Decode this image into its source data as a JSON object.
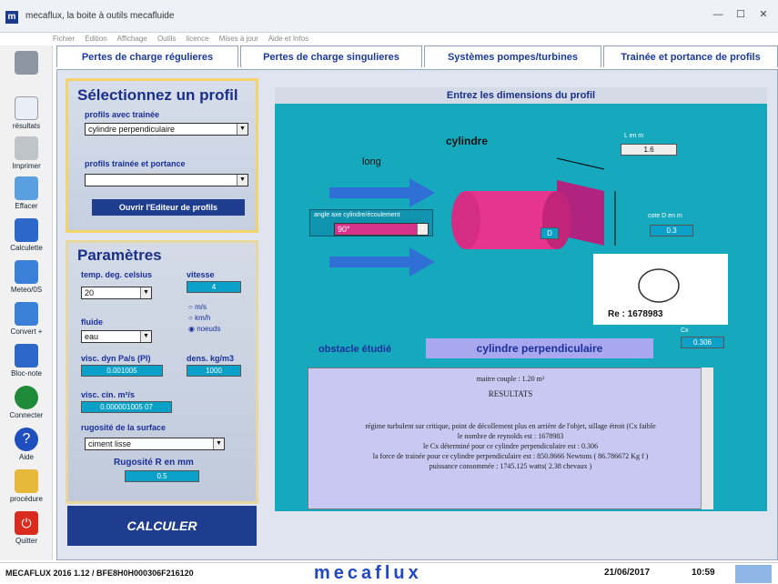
{
  "window": {
    "title": "mecaflux, la boite à outils mecafluide",
    "menu": [
      "Fichier",
      "Edition",
      "Affichage",
      "Outils",
      "licence",
      "Mises à jour",
      "Aide et Infos"
    ],
    "controls": [
      "—",
      "☐",
      "✕"
    ]
  },
  "sidebar": {
    "items": [
      {
        "label": ""
      },
      {
        "label": "résultats"
      },
      {
        "label": "Imprimer"
      },
      {
        "label": "Effacer"
      },
      {
        "label": "Calculette"
      },
      {
        "label": "Meteo/0S"
      },
      {
        "label": "Convert +"
      },
      {
        "label": "Bloc-note"
      },
      {
        "label": "Connecter"
      },
      {
        "label": "Aide"
      },
      {
        "label": "procédure"
      },
      {
        "label": "Quitter"
      }
    ]
  },
  "tabs": [
    "Pertes de charge régulieres",
    "Pertes de charge singulieres",
    "Systèmes pompes/turbines",
    "Trainée et portance de profils"
  ],
  "profile": {
    "heading": "Sélectionnez un profil",
    "drag_label": "profils avec trainée",
    "drag_value": "cylindre perpendiculaire",
    "lift_label": "profils trainée et portance",
    "lift_value": "",
    "editor_button": "Ouvrir l'Editeur de profils"
  },
  "params": {
    "heading": "Paramètres",
    "temp_label": "temp. deg. celsius",
    "temp_value": "20",
    "speed_label": "vitesse",
    "speed_value": "4",
    "units": [
      "m/s",
      "km/h",
      "noeuds"
    ],
    "fluid_label": "fluide",
    "fluid_value": "eau",
    "visc_dyn_label": "visc. dyn Pa/s (Pl)",
    "visc_dyn_value": "0.001005",
    "density_label": "dens. kg/m3",
    "density_value": "1000",
    "visc_cin_label": "visc. cin. m²/s",
    "visc_cin_value": "0.000001005 07",
    "roughness_label": "rugosité de la surface",
    "roughness_value": "ciment lisse",
    "roughness_mm_label": "Rugosité R en mm",
    "roughness_mm_value": "0.5"
  },
  "calc_button": "CALCULER",
  "dims": {
    "header": "Entrez les dimensions du profil",
    "shape": "cylindre",
    "long_label": "L en m",
    "long_value": "1.6",
    "long_dim": "long",
    "angle_label": "angle axe cylindre/écoulement",
    "angle_value": "90°",
    "diam_label": "cote D en m",
    "diam_value": "0.3",
    "d_marker": "D",
    "re_label": "Re : 1678983",
    "cx_label": "Cx",
    "cx_value": "0.306"
  },
  "obstacle": {
    "label": "obstacle étudié",
    "value": "cylindre perpendiculaire"
  },
  "results": {
    "lines": [
      "maitre couple : 1.20 m²",
      "RESULTATS",
      "régime turbulent sur critique, point de décollement plus en arrière de l'objet, sillage étroit (Cx faible",
      "le nombre de reynolds est : 1678983",
      "le Cx déterminé pour ce cylindre perpendiculaire est : 0.306",
      "la force de trainée pour ce cylindre perpendiculaire est : 850.8666 Newtons ( 86.786672 Kg f )",
      "puissance consommée : 1745.125 watts( 2.38 chevaux )"
    ]
  },
  "status": {
    "version": "MECAFLUX 2016 1.12 / BFE8H0H000306F216120",
    "logo": "mecaflux",
    "date": "21/06/2017",
    "time": "10:59"
  }
}
